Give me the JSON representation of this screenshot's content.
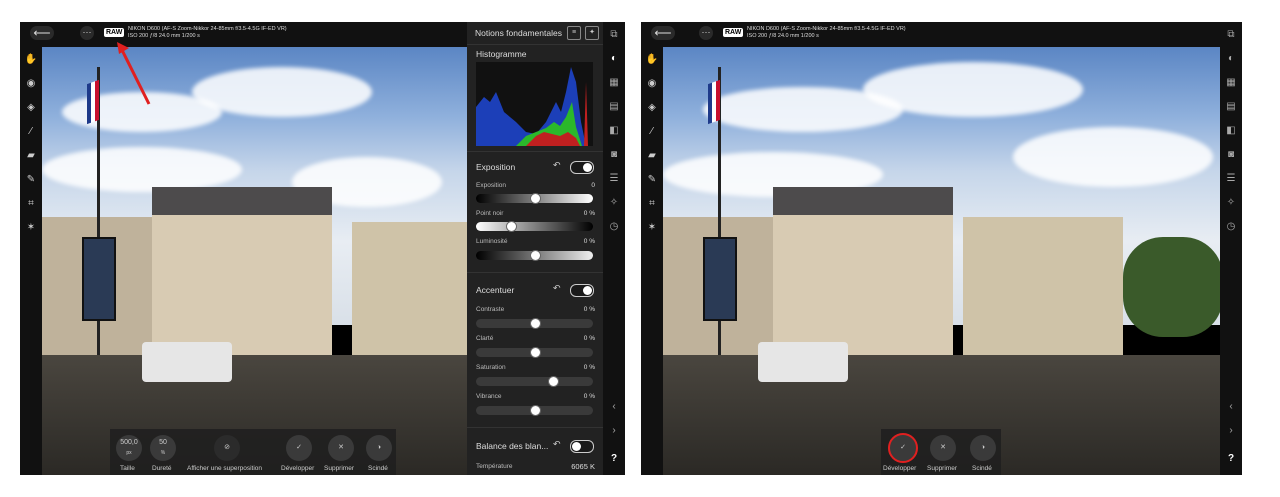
{
  "left": {
    "camera": {
      "badge": "RAW",
      "line1": "NIKON D600 (AF-S Zoom-Nikkor 24-85mm f/3.5-4.5G IF-ED VR)",
      "line2": "ISO 200 ƒ/8 24.0 mm 1/200 s"
    },
    "panel_title": "Notions fondamentales",
    "histogram_title": "Histogramme",
    "exposure": {
      "title": "Exposition",
      "sliders": [
        {
          "label": "Exposition",
          "value": "0"
        },
        {
          "label": "Point noir",
          "value": "0 %"
        },
        {
          "label": "Luminosité",
          "value": "0 %"
        }
      ]
    },
    "accent": {
      "title": "Accentuer",
      "sliders": [
        {
          "label": "Contraste",
          "value": "0 %"
        },
        {
          "label": "Clarté",
          "value": "0 %"
        },
        {
          "label": "Saturation",
          "value": "0 %"
        },
        {
          "label": "Vibrance",
          "value": "0 %"
        }
      ]
    },
    "white_balance": {
      "title": "Balance des blan...",
      "temp_label": "Température",
      "temp_value": "6065 K"
    },
    "bottom": {
      "size_value": "500,0",
      "size_unit": "px",
      "size_label": "Taille",
      "hardness_value": "50",
      "hardness_unit": "%",
      "hardness_label": "Dureté",
      "overlay_label": "Afficher une superposition",
      "develop_label": "Développer",
      "delete_label": "Supprimer",
      "split_label": "Scindé"
    }
  },
  "right": {
    "camera": {
      "badge": "RAW",
      "line1": "NIKON D600 (AF-S Zoom-Nikkor 24-85mm f/3.5-4.5G IF-ED VR)",
      "line2": "ISO 200 ƒ/8 24.0 mm 1/200 s"
    },
    "bottom": {
      "develop_label": "Développer",
      "delete_label": "Supprimer",
      "split_label": "Scindé"
    },
    "help": "?"
  },
  "colors": {
    "accent_red": "#e02020",
    "panel_bg": "#222222"
  }
}
